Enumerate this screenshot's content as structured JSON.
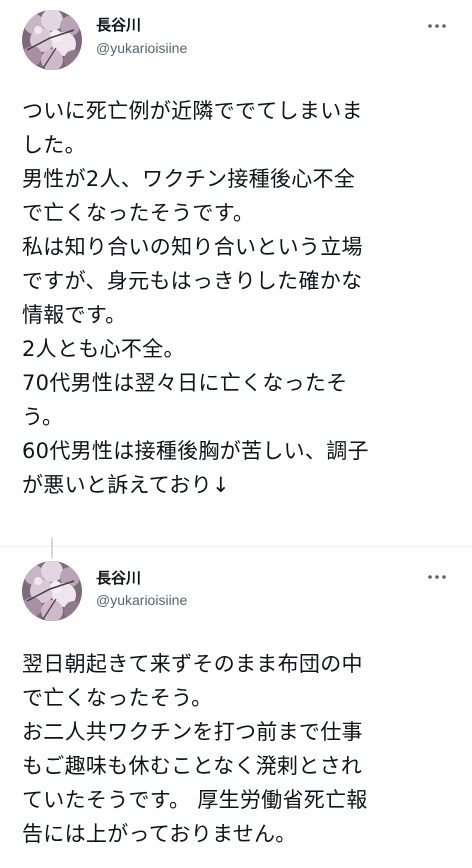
{
  "tweets": [
    {
      "author": {
        "display_name": "長谷川",
        "handle": "@yukarioisiine"
      },
      "more_icon": "ellipsis-icon",
      "lines": [
        "ついに死亡例が近隣ででてしまいま",
        "した。",
        "男性が2人、ワクチン接種後心不全",
        "で亡くなったそうです。",
        "私は知り合いの知り合いという立場",
        "ですが、身元もはっきりした確かな",
        "情報です。",
        "2人とも心不全。",
        "70代男性は翌々日に亡くなったそ",
        "う。",
        "60代男性は接種後胸が苦しい、調子",
        "が悪いと訴えており↓"
      ]
    },
    {
      "author": {
        "display_name": "長谷川",
        "handle": "@yukarioisiine"
      },
      "more_icon": "ellipsis-icon",
      "lines": [
        "翌日朝起きて来ずそのまま布団の中",
        "で亡くなったそう。",
        "お二人共ワクチンを打つ前まで仕事",
        "もご趣味も休むことなく溌剌とされ",
        "ていたそうです。 厚生労働省死亡報",
        "告には上がっておりません。"
      ]
    }
  ],
  "colors": {
    "text_primary": "#0f1419",
    "text_secondary": "#536471",
    "divider": "#eff3f4",
    "thread_line": "#cfd9de"
  }
}
